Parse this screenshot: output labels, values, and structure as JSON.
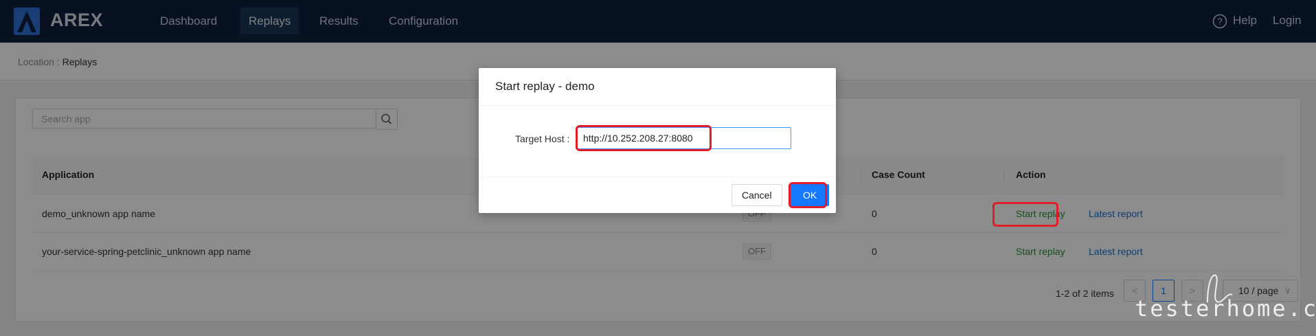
{
  "app": {
    "brand": "AREX",
    "nav": [
      {
        "label": "Dashboard",
        "active": false
      },
      {
        "label": "Replays",
        "active": true
      },
      {
        "label": "Results",
        "active": false
      },
      {
        "label": "Configuration",
        "active": false
      }
    ],
    "help_label": "Help",
    "login_label": "Login"
  },
  "breadcrumb": {
    "key": "Location :",
    "value": "Replays"
  },
  "search": {
    "placeholder": "Search app",
    "icon": "search-icon"
  },
  "table": {
    "headers": {
      "application": "Application",
      "case_count": "Case Count",
      "action": "Action"
    },
    "rows": [
      {
        "application": "demo_unknown app name",
        "status": "OFF",
        "case_count": "0",
        "start": "Start replay",
        "report": "Latest report"
      },
      {
        "application": "your-service-spring-petclinic_unknown app name",
        "status": "OFF",
        "case_count": "0",
        "start": "Start replay",
        "report": "Latest report"
      }
    ]
  },
  "pagination": {
    "info": "1-2 of 2 items",
    "current_page": "1",
    "page_size": "10 / page",
    "prev": "<",
    "next": ">"
  },
  "modal": {
    "title": "Start replay - demo",
    "field_label": "Target Host :",
    "field_value": "http://10.252.208.27:8080",
    "cancel_label": "Cancel",
    "ok_label": "OK"
  },
  "watermark": "testerhome.com",
  "colors": {
    "header_bg": "#0d1f3c",
    "primary": "#1677ff",
    "highlight": "#e11d2a",
    "link_green": "#2c8f3d",
    "link_blue": "#1a6fd1"
  }
}
